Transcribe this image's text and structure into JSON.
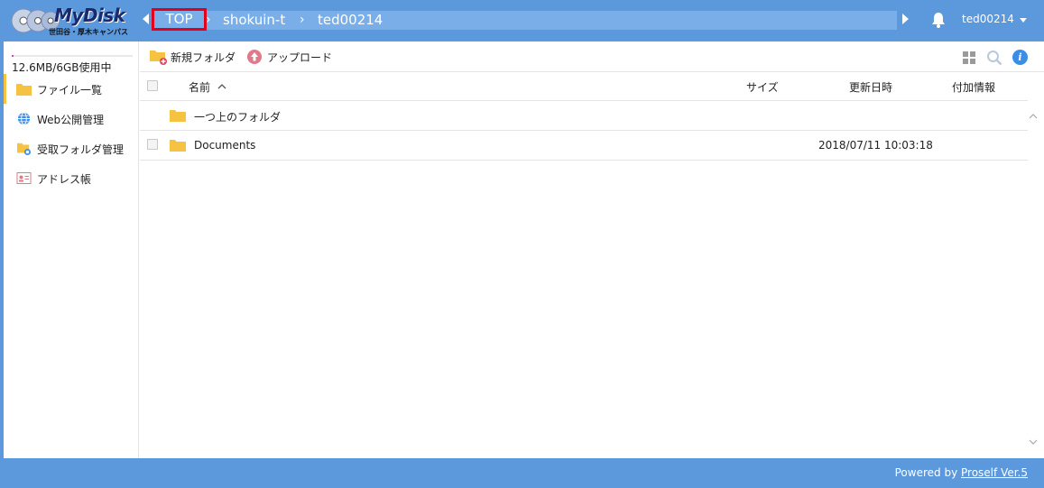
{
  "brand": {
    "title": "MyDisk",
    "subtitle": "世田谷・厚木キャンパス"
  },
  "breadcrumb": {
    "items": [
      "TOP",
      "shokuin-t",
      "ted00214"
    ],
    "separator": "›"
  },
  "user": {
    "name": "ted00214"
  },
  "sidebar": {
    "usage_text": "12.6MB/6GB使用中",
    "usage_fraction": 0.0021,
    "items": [
      {
        "label": "ファイル一覧",
        "icon": "folder-icon",
        "active": true
      },
      {
        "label": "Web公開管理",
        "icon": "globe-icon",
        "active": false
      },
      {
        "label": "受取フォルダ管理",
        "icon": "receive-folder-icon",
        "active": false
      },
      {
        "label": "アドレス帳",
        "icon": "address-book-icon",
        "active": false
      }
    ]
  },
  "toolbar": {
    "new_folder_label": "新規フォルダ",
    "upload_label": "アップロード"
  },
  "table": {
    "columns": {
      "name": "名前",
      "size": "サイズ",
      "modified": "更新日時",
      "info": "付加情報"
    },
    "sort_indicator": "^",
    "rows": [
      {
        "name": "一つ上のフォルダ",
        "size": "",
        "modified": "",
        "info": "",
        "checkbox": false
      },
      {
        "name": "Documents",
        "size": "",
        "modified": "2018/07/11 10:03:18",
        "info": "",
        "checkbox": true
      }
    ]
  },
  "footer": {
    "prefix": "Powered by ",
    "link": "Proself Ver.5"
  },
  "colors": {
    "header_blue": "#5b98dc",
    "breadcrumb_bar": "#79aee8",
    "highlight_red": "#e0001b",
    "folder_yellow": "#f5c242"
  }
}
